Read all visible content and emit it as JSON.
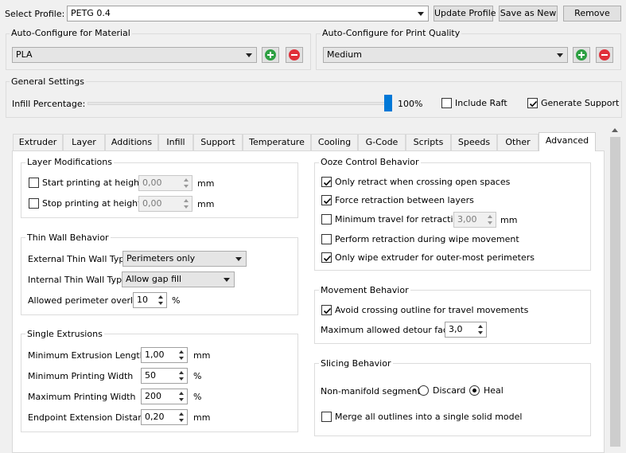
{
  "profile": {
    "label": "Select Profile:",
    "selected": "PETG 0.4",
    "update_button": "Update Profile",
    "save_as_new_button": "Save as New",
    "remove_button": "Remove"
  },
  "auto_material": {
    "title": "Auto-Configure for Material",
    "selected": "PLA"
  },
  "auto_quality": {
    "title": "Auto-Configure for Print Quality",
    "selected": "Medium"
  },
  "general": {
    "title": "General Settings",
    "infill_label": "Infill Percentage:",
    "infill_value": "100%",
    "infill_fraction": 1.0,
    "include_raft_label": "Include Raft",
    "include_raft_checked": false,
    "generate_support_label": "Generate Support",
    "generate_support_checked": true
  },
  "tabs": [
    {
      "label": "Extruder"
    },
    {
      "label": "Layer"
    },
    {
      "label": "Additions"
    },
    {
      "label": "Infill"
    },
    {
      "label": "Support"
    },
    {
      "label": "Temperature"
    },
    {
      "label": "Cooling"
    },
    {
      "label": "G-Code"
    },
    {
      "label": "Scripts"
    },
    {
      "label": "Speeds"
    },
    {
      "label": "Other"
    },
    {
      "label": "Advanced"
    }
  ],
  "active_tab": "Advanced",
  "layer_mods": {
    "title": "Layer Modifications",
    "start_label": "Start printing at height",
    "start_value": "0,00",
    "start_unit": "mm",
    "stop_label": "Stop printing at height",
    "stop_value": "0,00",
    "stop_unit": "mm"
  },
  "thin_wall": {
    "title": "Thin Wall Behavior",
    "external_label": "External Thin Wall Type",
    "external_value": "Perimeters only",
    "internal_label": "Internal Thin Wall Type",
    "internal_value": "Allow gap fill",
    "overlap_label": "Allowed perimeter overlap",
    "overlap_value": "10",
    "overlap_unit": "%"
  },
  "single_extrusions": {
    "title": "Single Extrusions",
    "min_length_label": "Minimum Extrusion Length",
    "min_length_value": "1,00",
    "min_length_unit": "mm",
    "min_width_label": "Minimum Printing Width",
    "min_width_value": "50",
    "min_width_unit": "%",
    "max_width_label": "Maximum Printing Width",
    "max_width_value": "200",
    "max_width_unit": "%",
    "endpoint_label": "Endpoint Extension Distance",
    "endpoint_value": "0,20",
    "endpoint_unit": "mm"
  },
  "ooze": {
    "title": "Ooze Control Behavior",
    "only_retract_label": "Only retract when crossing open spaces",
    "force_retract_label": "Force retraction between layers",
    "min_travel_label": "Minimum travel for retraction",
    "min_travel_value": "3,00",
    "min_travel_unit": "mm",
    "wipe_retract_label": "Perform retraction during wipe movement",
    "only_wipe_label": "Only wipe extruder for outer-most perimeters"
  },
  "movement": {
    "title": "Movement Behavior",
    "avoid_label": "Avoid crossing outline for travel movements",
    "detour_label": "Maximum allowed detour factor",
    "detour_value": "3,0"
  },
  "slicing": {
    "title": "Slicing Behavior",
    "nonmanifold_label": "Non-manifold segments:",
    "discard_label": "Discard",
    "heal_label": "Heal",
    "merge_label": "Merge all outlines into a single solid model"
  },
  "colors": {
    "accent": "#0078d7",
    "add_green": "#2ea043",
    "remove_red": "#e0303a"
  }
}
